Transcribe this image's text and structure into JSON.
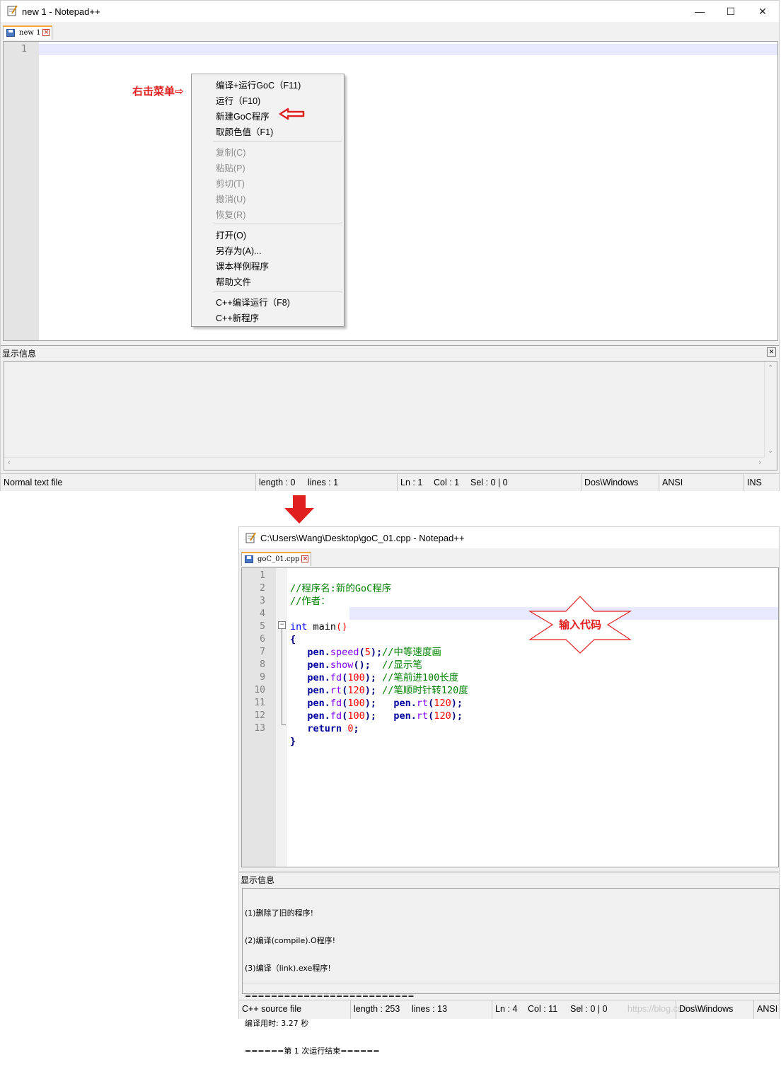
{
  "window1": {
    "title": "new 1 - Notepad++",
    "controls": {
      "minimize": "—",
      "maximize": "☐",
      "close": "✕"
    },
    "tab_label": "new 1",
    "line_numbers": [
      "1"
    ],
    "annotation": "右击菜单⇨",
    "context_menu": {
      "groups": [
        [
          {
            "label": "编译+运行GoC（F11)",
            "enabled": true
          },
          {
            "label": "运行（F10)",
            "enabled": true
          },
          {
            "label": "新建GoC程序",
            "enabled": true
          },
          {
            "label": "取颜色值（F1)",
            "enabled": true
          }
        ],
        [
          {
            "label": "复制(C)",
            "enabled": false
          },
          {
            "label": "粘贴(P)",
            "enabled": false
          },
          {
            "label": "剪切(T)",
            "enabled": false
          },
          {
            "label": "撤消(U)",
            "enabled": false
          },
          {
            "label": "恢复(R)",
            "enabled": false
          }
        ],
        [
          {
            "label": "打开(O)",
            "enabled": true
          },
          {
            "label": "另存为(A)...",
            "enabled": true
          },
          {
            "label": "课本样例程序",
            "enabled": true
          },
          {
            "label": "帮助文件",
            "enabled": true
          }
        ],
        [
          {
            "label": "C++编译运行（F8)",
            "enabled": true
          },
          {
            "label": "C++新程序",
            "enabled": true
          }
        ]
      ]
    },
    "panel_title": "显示信息",
    "panel_close": "✕",
    "status": {
      "file_type": "Normal text file",
      "length": "length : 0",
      "lines": "lines : 1",
      "ln": "Ln : 1",
      "col": "Col : 1",
      "sel": "Sel : 0 | 0",
      "eol": "Dos\\Windows",
      "encoding": "ANSI",
      "mode": "INS"
    }
  },
  "window2": {
    "title": "C:\\Users\\Wang\\Desktop\\goC_01.cpp - Notepad++",
    "tab_label": "goC_01.cpp",
    "line_numbers": [
      "1",
      "2",
      "3",
      "4",
      "5",
      "6",
      "7",
      "8",
      "9",
      "10",
      "11",
      "12",
      "13"
    ],
    "fold_marker": "⊟",
    "annotation": "输入代码",
    "panel_title": "显示信息",
    "output_lines": [
      "(1)删除了旧的程序!",
      "(2)编译(compile).O程序!",
      "(3)编译（link).exe程序!",
      "==========================",
      "编译用时: 3.27 秒",
      "======第 1 次运行结束======"
    ],
    "status": {
      "file_type": "C++ source file",
      "length": "length : 253",
      "lines": "lines : 13",
      "ln": "Ln : 4",
      "col": "Col : 11",
      "sel": "Sel : 0 | 0",
      "eol": "Dos\\Windows",
      "encoding": "ANSI"
    },
    "watermark": "https://blog.csdn.net/..."
  },
  "code": {
    "l1": "//程序名:新的GoC程序",
    "l2": "//作者：",
    "l4_kw": "int",
    "l4_fn": "main",
    "l4_paren": "()",
    "l5": "{",
    "pen": "pen",
    "dot": ".",
    "speed": "speed",
    "show": "show",
    "fd": "fd",
    "rt": "rt",
    "ret": "return",
    "v5": "5",
    "v100": "100",
    "v120": "120",
    "v0": "0",
    "c6": "//中等速度画",
    "c7": "//显示笔",
    "c8": "//笔前进100长度",
    "c9": "//笔顺时针转120度",
    "l13": "}"
  },
  "colors": {
    "accent_red": "#e0201f",
    "current_line": "#e8e8ff",
    "tab_top": "#f4a73a"
  }
}
